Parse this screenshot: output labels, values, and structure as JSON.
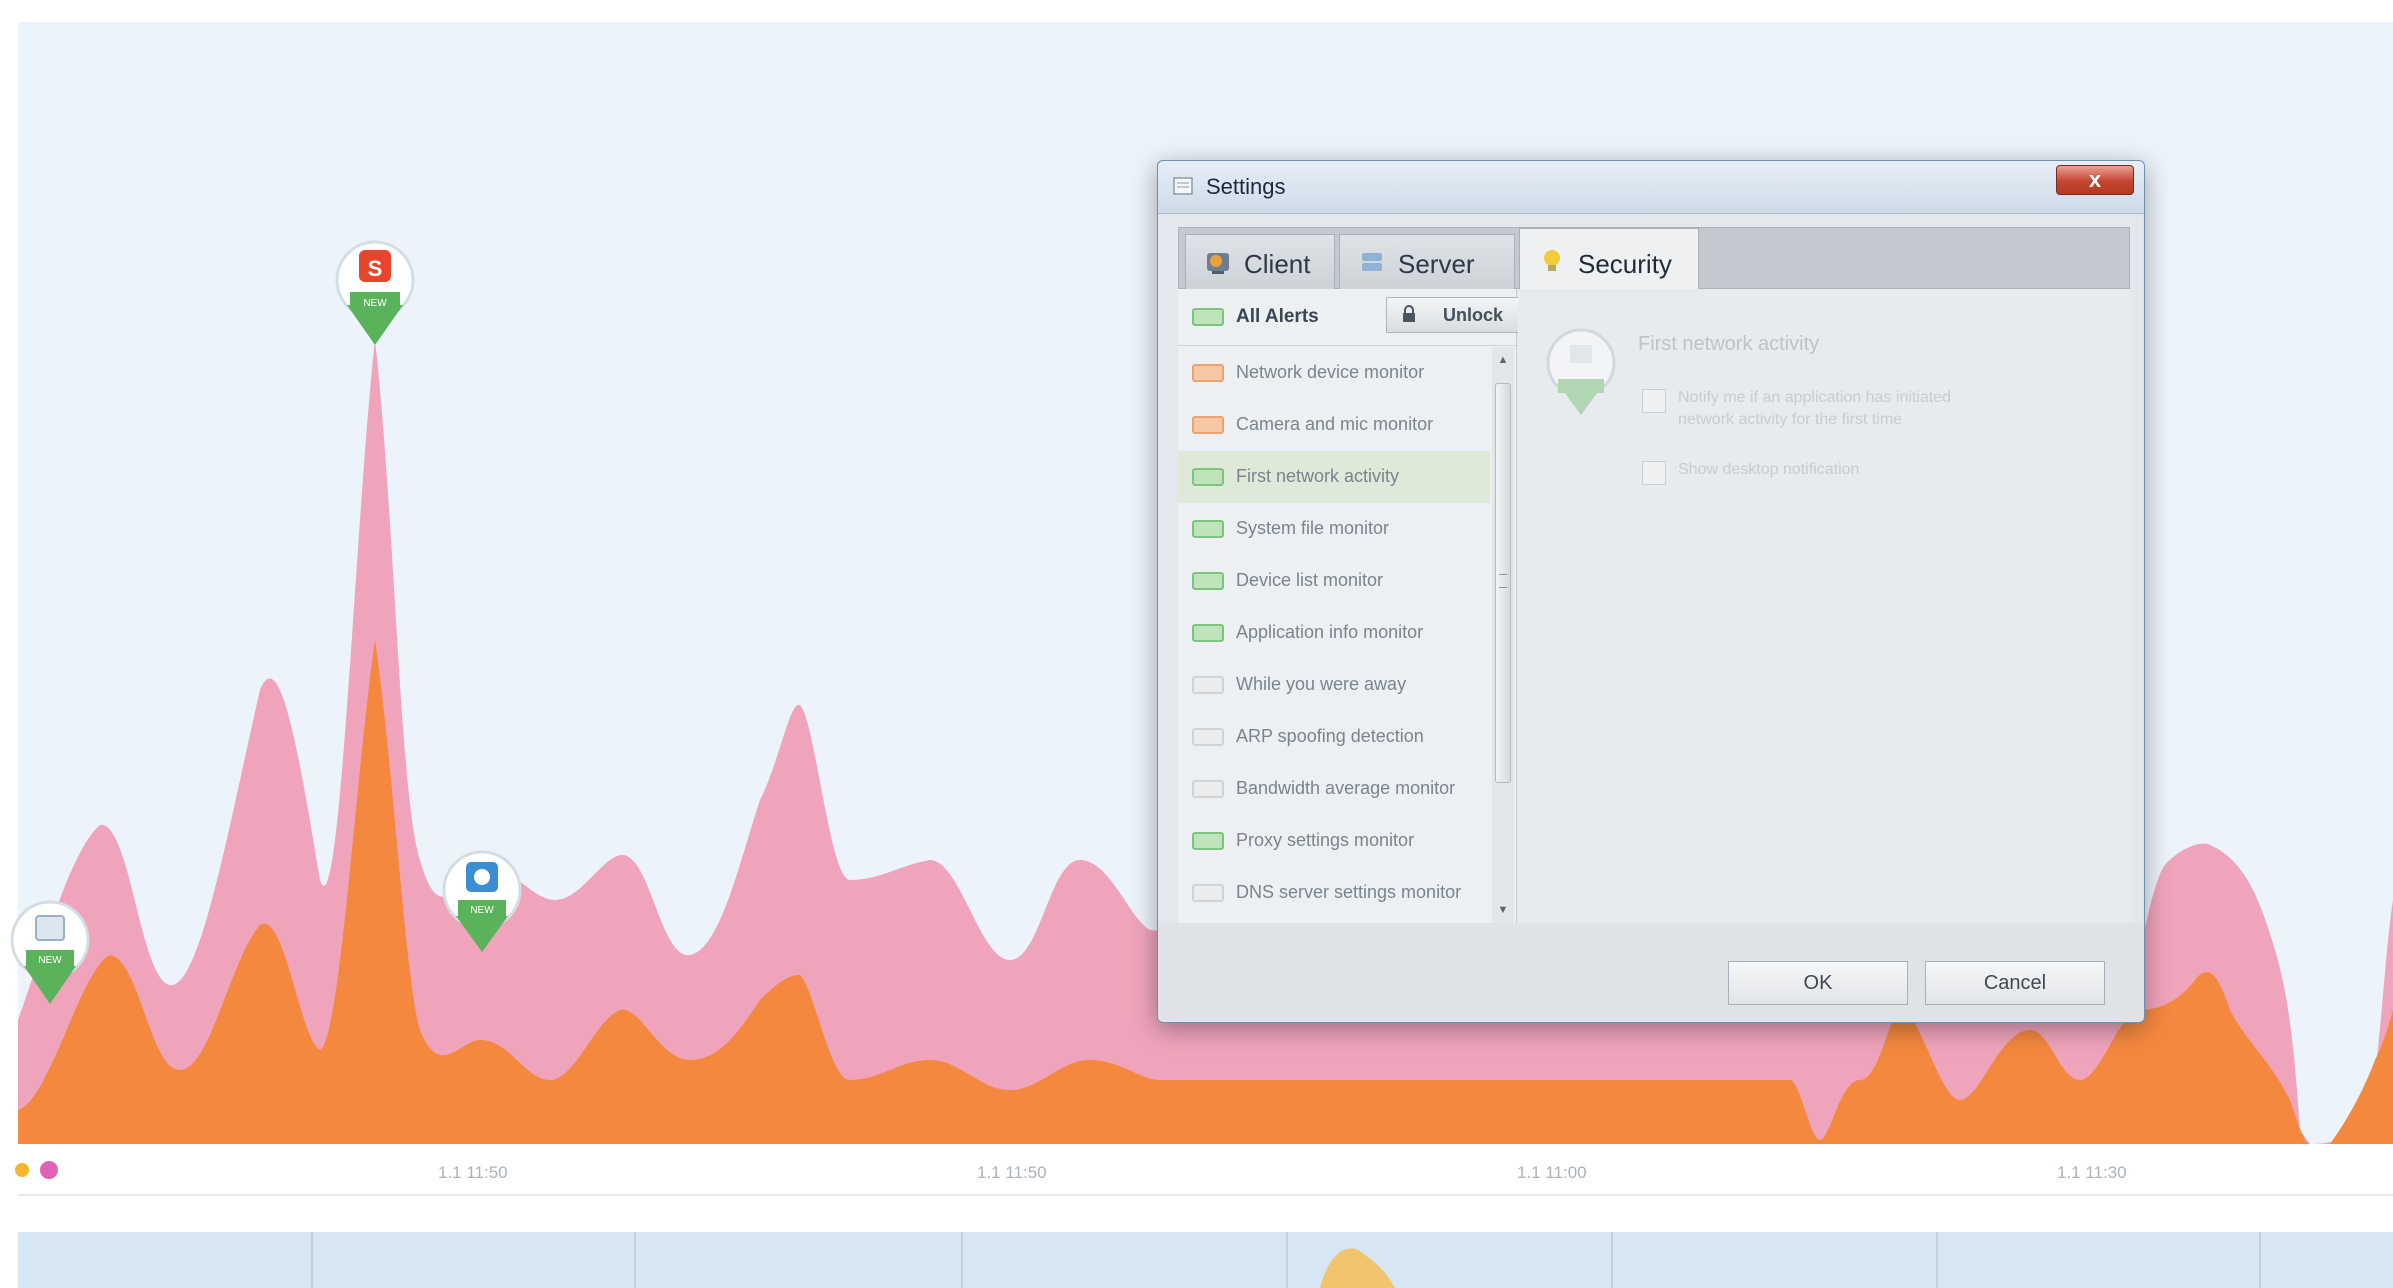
{
  "timeline": {
    "time_labels": [
      "1.1 11:50",
      "1.1 11:50",
      "1.1 11:00",
      "1.1 11:30"
    ],
    "colors": {
      "upper_area": "#f0a4bb",
      "lower_area": "#f5883f",
      "background": "#ecf3fa",
      "legend_dot_yellow": "#f7b52a",
      "legend_dot_pink": "#e062b7"
    },
    "markers": [
      {
        "name": "app-marker-red",
        "badge": "NEW"
      },
      {
        "name": "app-marker-blue",
        "badge": "NEW"
      },
      {
        "name": "app-marker-doc",
        "badge": "NEW"
      }
    ]
  },
  "settings": {
    "title": "Settings",
    "close_label": "x",
    "tabs": [
      {
        "label": "Client",
        "icon": "client-icon"
      },
      {
        "label": "Server",
        "icon": "server-icon"
      },
      {
        "label": "Security",
        "icon": "bulb-icon",
        "active": true
      }
    ],
    "all_alerts_label": "All Alerts",
    "unlock_label": "Unlock",
    "alerts": [
      {
        "label": "Network device monitor",
        "state": "orange"
      },
      {
        "label": "Camera and mic monitor",
        "state": "orange"
      },
      {
        "label": "First network activity",
        "state": "green",
        "selected": true
      },
      {
        "label": "System file monitor",
        "state": "green"
      },
      {
        "label": "Device list monitor",
        "state": "green"
      },
      {
        "label": "Application info monitor",
        "state": "green"
      },
      {
        "label": "While you were away",
        "state": "grey"
      },
      {
        "label": "ARP spoofing detection",
        "state": "grey"
      },
      {
        "label": "Bandwidth average monitor",
        "state": "grey"
      },
      {
        "label": "Proxy settings monitor",
        "state": "green"
      },
      {
        "label": "DNS server settings monitor",
        "state": "grey"
      }
    ],
    "detail": {
      "title": "First network activity",
      "option1": "Notify me if an application has initiated network activity for the first time",
      "option2": "Show desktop notification"
    },
    "ok_label": "OK",
    "cancel_label": "Cancel"
  }
}
